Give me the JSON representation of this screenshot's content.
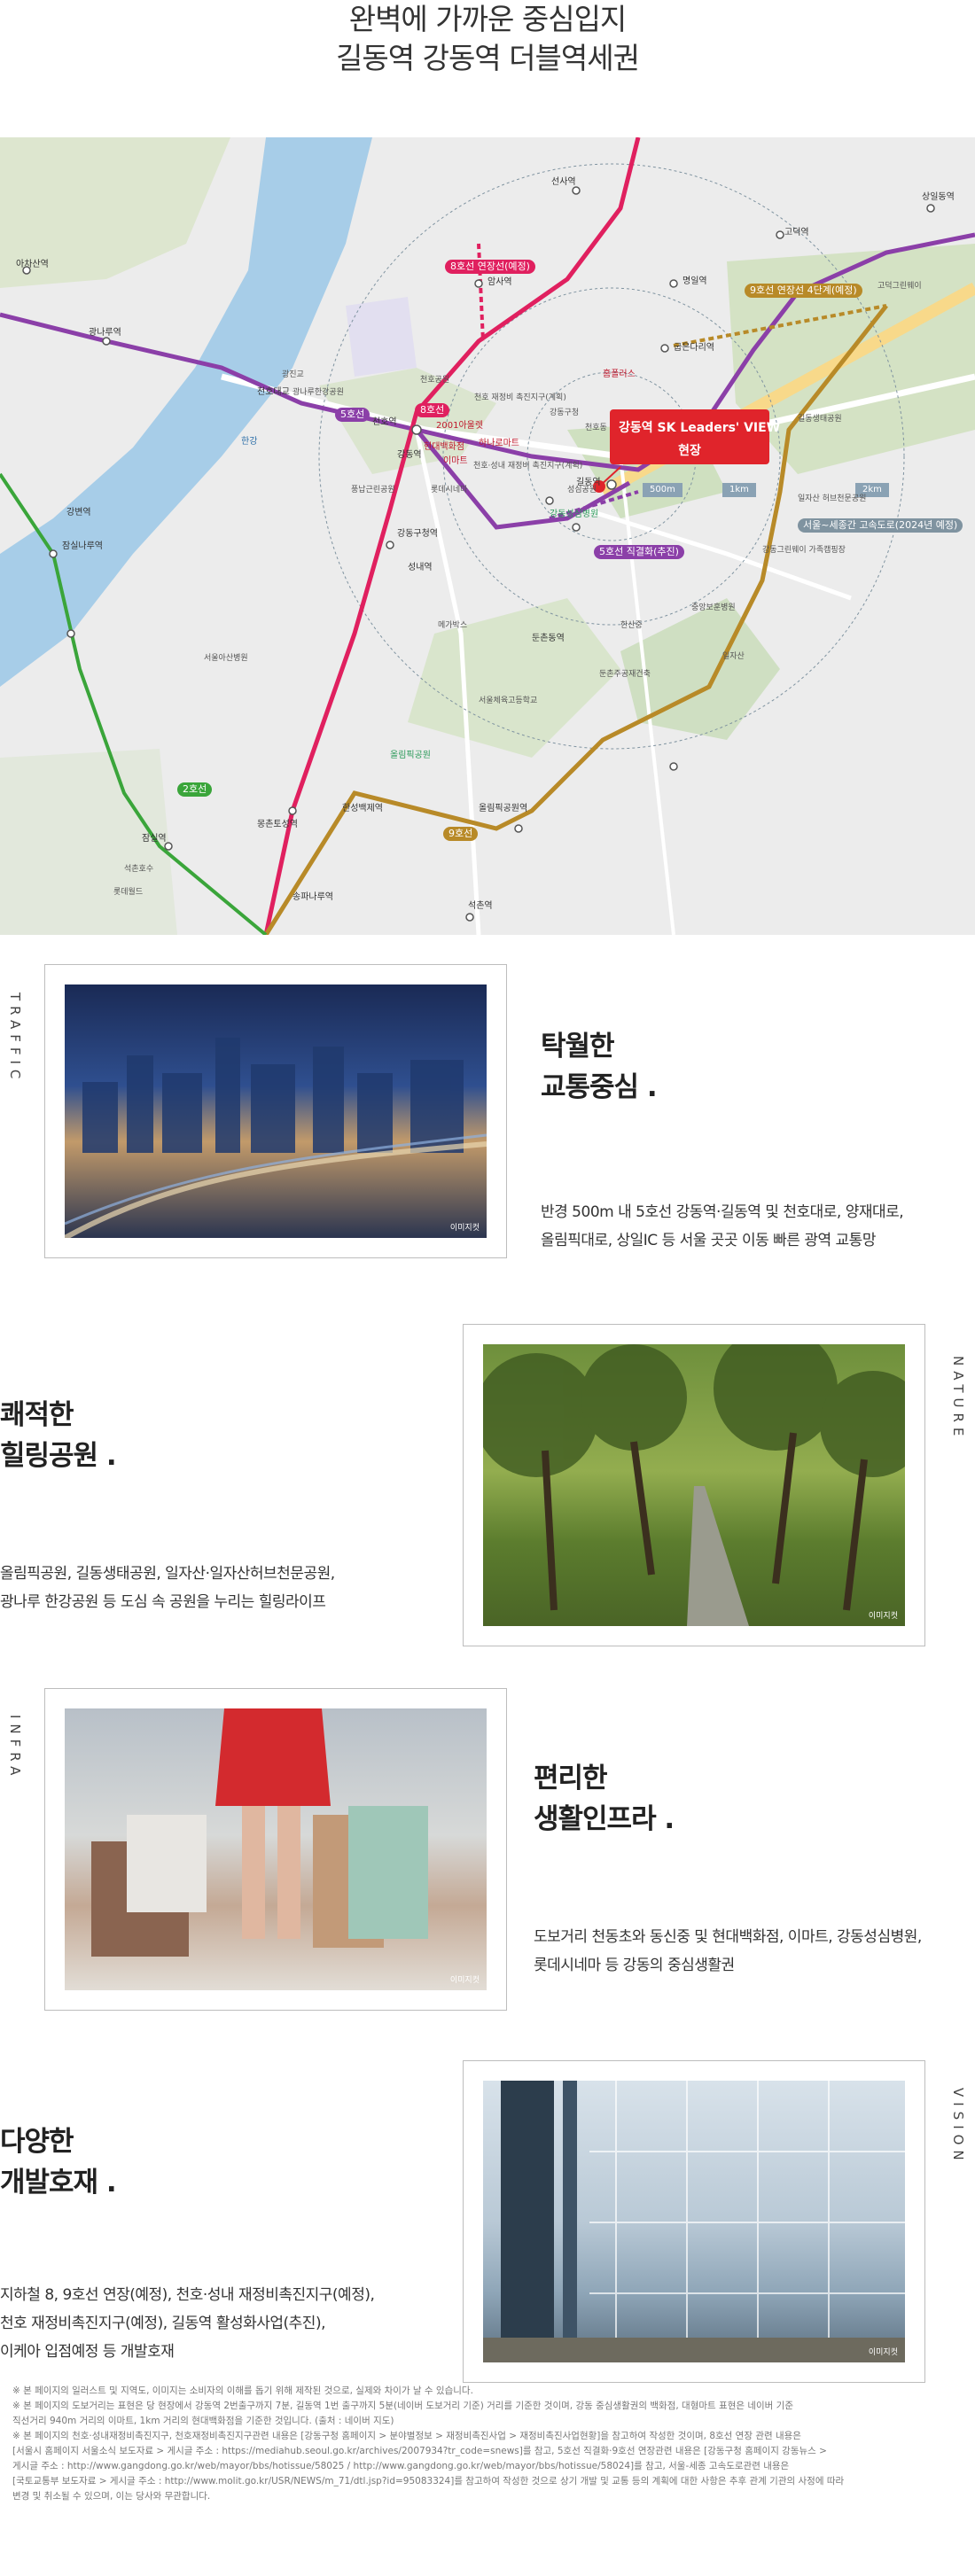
{
  "header": {
    "line1": "완벽에 가까운 중심입지",
    "line2": "길동역 강동역 더블역세권"
  },
  "map": {
    "site_brand": "강동역 SK Leaders' VIEW",
    "site_label": "현장",
    "line_tags": {
      "line5": "5호선",
      "line8": "8호선",
      "line8_ext": "8호선 연장선(예정)",
      "line9_ext": "9호선 연장선 4단계(예정)",
      "line5_direct": "5호선 직결화(추진)",
      "line2": "2호선",
      "line9": "9호선",
      "expressway": "서울~세종간 고속도로(2024년 예정)"
    },
    "distances": [
      "500m",
      "1km",
      "2km"
    ],
    "stations": [
      "선사역",
      "상일동역",
      "고덕역",
      "명일역",
      "굽은다리역",
      "길동역",
      "강동역",
      "천호역",
      "암사역",
      "둔촌동역",
      "올림픽공원역",
      "한성백제역",
      "송파나루역",
      "석촌역",
      "잠실역",
      "몽촌토성역",
      "강동구청역",
      "아차산역",
      "광나루역",
      "잠실나루역",
      "강변역",
      "천호대교",
      "성내역"
    ],
    "places": [
      "광진교",
      "한강",
      "광나루한강공원",
      "천호공원",
      "2001아울렛",
      "하나로마트",
      "이마트",
      "현대백화점",
      "롯데시네마",
      "강동구청",
      "천호 재정비 촉진지구(계획)",
      "천호·성내 재정비 촉진지구(계획)",
      "홈플러스",
      "강동성심병원",
      "천호동",
      "길동생태공원",
      "고덕그린웨이",
      "강동그린웨이 가족캠핑장",
      "올림픽공원",
      "서울아산병원",
      "일자산",
      "일자산 허브천문공원",
      "성심공원",
      "풍납근린공원",
      "메가박스",
      "롯데월드",
      "석촌호수",
      "중앙보훈병원",
      "서울체육고등학교",
      "한산중",
      "둔촌주공재건축"
    ]
  },
  "sections": [
    {
      "label": "TRAFFIC",
      "title_1": "탁월한",
      "title_2": "교통중심 .",
      "body_1": "반경 500m 내 5호선 강동역·길동역 및 천호대로, 양재대로,",
      "body_2": "올림픽대로, 상일IC 등 서울 곳곳 이동 빠른 광역 교통망",
      "caption": "이미지컷"
    },
    {
      "label": "NATURE",
      "title_1": "쾌적한",
      "title_2": "힐링공원 .",
      "body_1": "올림픽공원, 길동생태공원, 일자산·일자산허브천문공원,",
      "body_2": "광나루 한강공원 등 도심 속 공원을 누리는 힐링라이프",
      "caption": "이미지컷"
    },
    {
      "label": "INFRA",
      "title_1": "편리한",
      "title_2": "생활인프라 .",
      "body_1": "도보거리 천동초와 동신중 및 현대백화점, 이마트, 강동성심병원,",
      "body_2": "롯데시네마 등 강동의 중심생활권",
      "caption": "이미지컷"
    },
    {
      "label": "VISION",
      "title_1": "다양한",
      "title_2": "개발호재 .",
      "body_1": "지하철 8, 9호선 연장(예정), 천호·성내 재정비촉진지구(예정),",
      "body_2": "천호 재정비촉진지구(예정), 길동역 활성화사업(추진),",
      "body_3": "이케아 입점예정 등 개발호재",
      "caption": "이미지컷"
    }
  ],
  "footnotes": [
    "※ 본 페이지의 일러스트 및 지역도, 이미지는 소비자의 이해를 돕기 위해 제작된 것으로, 실제와 차이가 날 수 있습니다.",
    "※ 본 페이지의 도보거리는 표현은 당 현장에서 강동역 2번출구까지 7분, 길동역 1번 출구까지 5분(네이버 도보거리 기준) 거리를 기준한 것이며, 강동 중심생활권의 백화점, 대형마트 표현은 네이버 기준",
    "직선거리 940m 거리의 이마트, 1km 거리의 현대백화점을 기준한 것입니다. (출처 : 네이버 지도)",
    "※ 본 페이지의 천호·성내재정비촉진지구, 천호재정비촉진지구관련 내용은 [강동구청 홈페이지 > 분야별정보 > 재정비촉진사업 > 재정비촉진사업현황]을 참고하여 작성한 것이며, 8호선 연장 관련 내용은",
    "[서울시 홈페이지 서울소식 보도자료 > 게시글 주소 : https://mediahub.seoul.go.kr/archives/2007934?tr_code=snews]를 참고, 5호선 직결화·9호선 연장관련 내용은 [강동구청 홈페이지 강동뉴스 >",
    "게시글 주소 : http://www.gangdong.go.kr/web/mayor/bbs/hotissue/58025 / http://www.gangdong.go.kr/web/mayor/bbs/hotissue/58024]를 참고, 서울-세종 고속도로관련 내용은",
    "[국토교통부 보도자료 > 게시글 주소 : http://www.molit.go.kr/USR/NEWS/m_71/dtl.jsp?id=95083324]를 참고하여 작성한 것으로 상기 개발 및 교통 등의 계획에 대한 사항은 추후 관계 기관의 사정에 따라",
    "변경 및 취소될 수 있으며, 이는 당사와 무관합니다."
  ],
  "colors": {
    "line5": "#8b3fa8",
    "line8": "#e0205f",
    "line9": "#b88a28",
    "line2": "#3aa53a",
    "site": "#e0242b",
    "river": "#a7cde8"
  }
}
